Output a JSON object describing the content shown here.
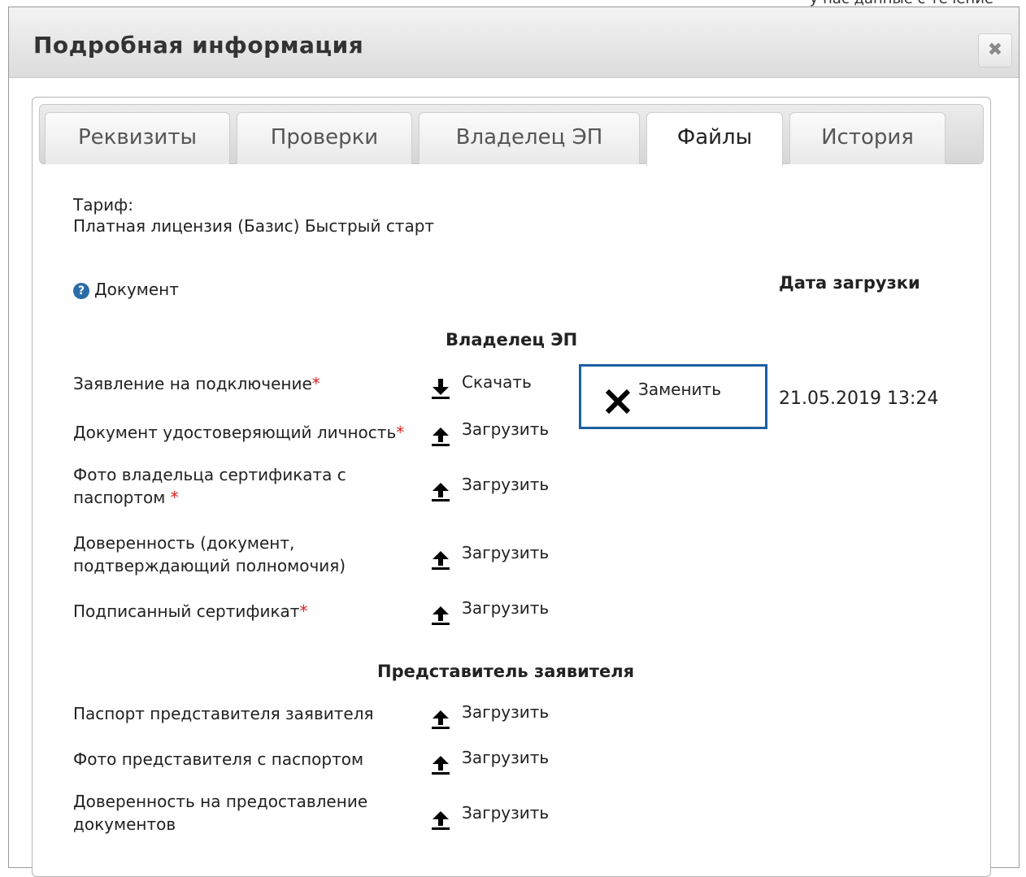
{
  "top_strip_text": "у нас данные с течение",
  "dialog": {
    "title": "Подробная информация",
    "close_icon": "close-icon"
  },
  "tabs": [
    {
      "label": "Реквизиты",
      "active": false
    },
    {
      "label": "Проверки",
      "active": false
    },
    {
      "label": "Владелец ЭП",
      "active": false
    },
    {
      "label": "Файлы",
      "active": true
    },
    {
      "label": "История",
      "active": false
    }
  ],
  "tariff": {
    "label": "Тариф:",
    "value": "Платная лицензия (Базис) Быстрый старт"
  },
  "columns": {
    "document": "Документ",
    "upload_date": "Дата загрузки"
  },
  "sections": [
    {
      "title": "Владелец ЭП",
      "rows": [
        {
          "line1": "Заявление на подключение",
          "required": true,
          "action": "Скачать",
          "replace": "Заменить",
          "date": "21.05.2019 13:24"
        },
        {
          "line1": "Документ удостоверяющий личность",
          "required": true,
          "action": "Загрузить"
        },
        {
          "line1": "Фото владельца сертификата с",
          "line2": "паспортом ",
          "required": true,
          "action": "Загрузить"
        },
        {
          "line1": "Доверенность (документ,",
          "line2": "подтверждающий полномочия)",
          "required": false,
          "action": "Загрузить"
        },
        {
          "line1": "Подписанный сертификат",
          "required": true,
          "action": "Загрузить"
        }
      ]
    },
    {
      "title": "Представитель заявителя",
      "rows": [
        {
          "line1": "Паспорт представителя заявителя",
          "required": false,
          "action": "Загрузить"
        },
        {
          "line1": "Фото представителя с паспортом",
          "required": false,
          "action": "Загрузить"
        },
        {
          "line1": "Доверенность на предоставление",
          "line2": "документов",
          "required": false,
          "action": "Загрузить"
        }
      ]
    }
  ],
  "required_mark": "*",
  "help_icon_glyph": "?"
}
